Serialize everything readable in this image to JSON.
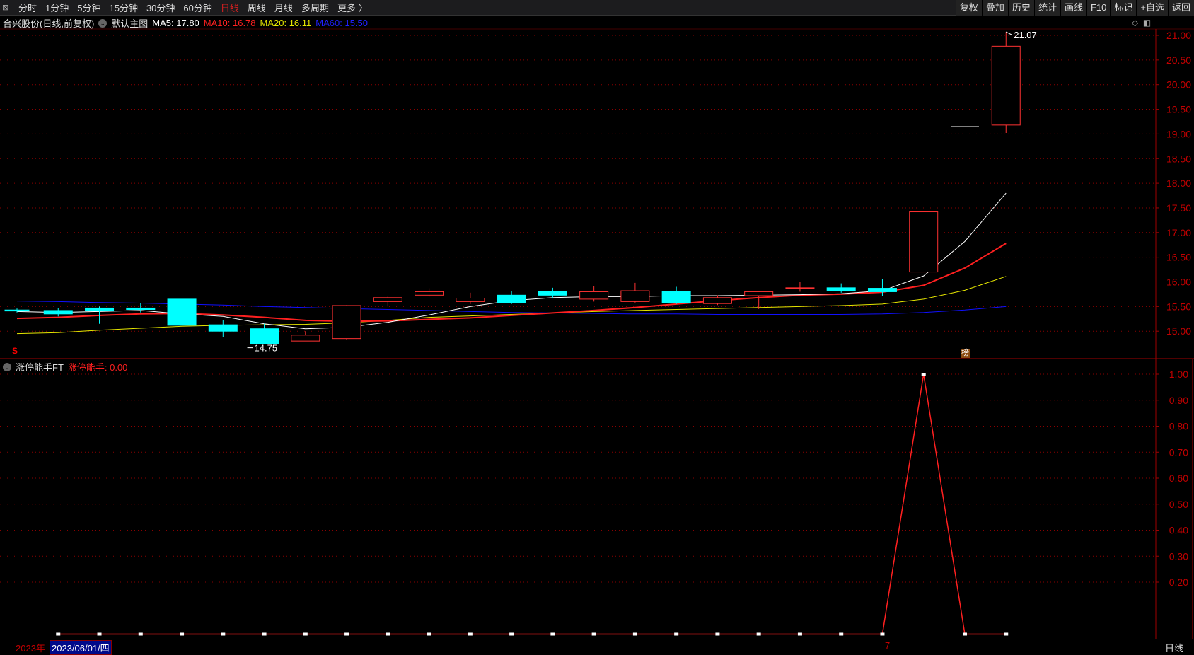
{
  "toolbar": {
    "tabs": [
      "分时",
      "1分钟",
      "5分钟",
      "15分钟",
      "30分钟",
      "60分钟",
      "日线",
      "周线",
      "月线",
      "多周期",
      "更多 〉"
    ],
    "active": "日线",
    "right_buttons": [
      "复权",
      "叠加",
      "历史",
      "统计",
      "画线",
      "F10",
      "标记",
      "+自选",
      "返回"
    ]
  },
  "main_legend": {
    "title": "合兴股份(日线,前复权)",
    "template": "默认主图",
    "ma5": "MA5: 17.80",
    "ma10": "MA10: 16.78",
    "ma20": "MA20: 16.11",
    "ma60": "MA60: 15.50"
  },
  "indicator_legend": {
    "name": "涨停能手FT",
    "value": "涨停能手: 0.00"
  },
  "colors": {
    "up": "#ff3232",
    "down": "#00ffff",
    "ma5": "#ffffff",
    "ma10": "#ff2020",
    "ma20": "#e6e600",
    "ma60": "#1010ff",
    "axis": "#a00000"
  },
  "annotations": {
    "high": "21.07",
    "low": "14.75",
    "s_marker": "S",
    "bang_marker": "榜"
  },
  "bottom": {
    "year": "2023年",
    "cursor_date": "2023/06/01/四",
    "month_marker": "7",
    "period": "日线"
  },
  "chart_data": {
    "type": "candlestick",
    "price_axis": {
      "ticks": [
        "21.00",
        "20.50",
        "20.00",
        "19.50",
        "19.00",
        "18.50",
        "18.00",
        "17.50",
        "17.00",
        "16.50",
        "16.00",
        "15.50",
        "15.00"
      ],
      "ylim": [
        15.0,
        21.0
      ]
    },
    "candles": [
      {
        "o": 15.43,
        "c": 15.41,
        "h": 15.46,
        "l": 15.38
      },
      {
        "o": 15.42,
        "c": 15.35,
        "h": 15.47,
        "l": 15.3
      },
      {
        "o": 15.47,
        "c": 15.42,
        "h": 15.5,
        "l": 15.15
      },
      {
        "o": 15.47,
        "c": 15.44,
        "h": 15.57,
        "l": 15.38
      },
      {
        "o": 15.65,
        "c": 15.12,
        "h": 15.65,
        "l": 15.12
      },
      {
        "o": 15.13,
        "c": 15.0,
        "h": 15.22,
        "l": 14.88
      },
      {
        "o": 15.05,
        "c": 14.75,
        "h": 15.15,
        "l": 14.75
      },
      {
        "o": 14.8,
        "c": 14.92,
        "h": 15.0,
        "l": 14.8
      },
      {
        "o": 14.85,
        "c": 15.52,
        "h": 15.53,
        "l": 14.83
      },
      {
        "o": 15.6,
        "c": 15.68,
        "h": 15.7,
        "l": 15.5
      },
      {
        "o": 15.73,
        "c": 15.8,
        "h": 15.87,
        "l": 15.7
      },
      {
        "o": 15.6,
        "c": 15.67,
        "h": 15.78,
        "l": 15.55
      },
      {
        "o": 15.73,
        "c": 15.57,
        "h": 15.82,
        "l": 15.55
      },
      {
        "o": 15.8,
        "c": 15.73,
        "h": 15.88,
        "l": 15.67
      },
      {
        "o": 15.65,
        "c": 15.8,
        "h": 15.92,
        "l": 15.6
      },
      {
        "o": 15.6,
        "c": 15.82,
        "h": 15.98,
        "l": 15.58
      },
      {
        "o": 15.8,
        "c": 15.58,
        "h": 15.9,
        "l": 15.55
      },
      {
        "o": 15.56,
        "c": 15.68,
        "h": 15.73,
        "l": 15.53
      },
      {
        "o": 15.72,
        "c": 15.8,
        "h": 15.82,
        "l": 15.45
      },
      {
        "o": 15.87,
        "c": 15.88,
        "h": 16.0,
        "l": 15.8
      },
      {
        "o": 15.88,
        "c": 15.82,
        "h": 15.97,
        "l": 15.78
      },
      {
        "o": 15.87,
        "c": 15.8,
        "h": 16.05,
        "l": 15.72
      },
      {
        "o": 16.2,
        "c": 17.42,
        "h": 17.42,
        "l": 16.2
      },
      {
        "o": 19.15,
        "c": 19.15,
        "h": 19.15,
        "l": 19.15
      },
      {
        "o": 19.18,
        "c": 20.78,
        "h": 21.07,
        "l": 19.02
      }
    ],
    "ma5": [
      15.4,
      15.38,
      15.4,
      15.42,
      15.35,
      15.3,
      15.15,
      15.05,
      15.08,
      15.18,
      15.33,
      15.5,
      15.62,
      15.68,
      15.7,
      15.7,
      15.72,
      15.72,
      15.73,
      15.74,
      15.76,
      15.82,
      16.12,
      16.82,
      17.8
    ],
    "ma10": [
      15.26,
      15.28,
      15.32,
      15.35,
      15.36,
      15.33,
      15.28,
      15.22,
      15.2,
      15.21,
      15.24,
      15.27,
      15.32,
      15.37,
      15.42,
      15.48,
      15.55,
      15.62,
      15.68,
      15.73,
      15.75,
      15.79,
      15.93,
      16.28,
      16.78
    ],
    "ma20": [
      14.95,
      14.97,
      15.02,
      15.06,
      15.1,
      15.12,
      15.13,
      15.14,
      15.17,
      15.22,
      15.28,
      15.31,
      15.34,
      15.37,
      15.4,
      15.42,
      15.44,
      15.46,
      15.48,
      15.5,
      15.52,
      15.55,
      15.65,
      15.83,
      16.11
    ],
    "ma60": [
      15.61,
      15.6,
      15.58,
      15.57,
      15.55,
      15.53,
      15.5,
      15.48,
      15.46,
      15.44,
      15.42,
      15.4,
      15.38,
      15.37,
      15.36,
      15.35,
      15.35,
      15.34,
      15.34,
      15.34,
      15.34,
      15.35,
      15.38,
      15.43,
      15.5
    ],
    "indicator": {
      "name": "涨停能手",
      "ticks": [
        "1.00",
        "0.90",
        "0.80",
        "0.70",
        "0.60",
        "0.50",
        "0.40",
        "0.30",
        "0.20"
      ],
      "ylim": [
        0,
        1
      ],
      "values": [
        0,
        0,
        0,
        0,
        0,
        0,
        0,
        0,
        0,
        0,
        0,
        0,
        0,
        0,
        0,
        0,
        0,
        0,
        0,
        0,
        0,
        1,
        0,
        0
      ]
    }
  }
}
